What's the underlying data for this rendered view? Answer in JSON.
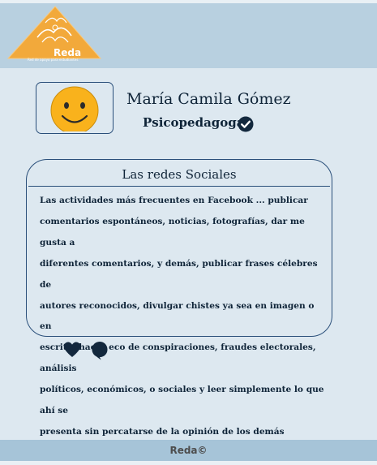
{
  "header": {
    "logo_name": "Reda",
    "logo_tagline": "Red de apoyo para estudiantes",
    "logo_icon": "mountain-hands-logo",
    "logo_color": "#f2a93b"
  },
  "profile": {
    "name": "María Camila Gómez",
    "role": "Psicopedagoga",
    "avatar_icon": "smiley-face-icon",
    "verified_icon": "verified-check-icon"
  },
  "post": {
    "title": "Las redes Sociales",
    "body_lines": [
      "Las actividades más frecuentes en Facebook ... publicar",
      "comentarios espontáneos, noticias, fotografías,  dar me gusta a",
      "diferentes comentarios, y demás, publicar frases célebres de",
      "autores reconocidos, divulgar chistes ya sea en imagen o en",
      "escrito, hacer eco de conspiraciones, fraudes electorales, análisis",
      "políticos, económicos, o sociales y leer simplemente lo que ahí se",
      "presenta sin percatarse de la opinión de los demás"
    ]
  },
  "reactions": {
    "like_icon": "heart-icon",
    "comment_icon": "speech-bubble-icon"
  },
  "footer": {
    "text": "Reda©"
  },
  "colors": {
    "header_bg": "#b8d0e0",
    "page_bg": "#dde8f0",
    "text": "#0f2438",
    "accent": "#f2a93b"
  }
}
